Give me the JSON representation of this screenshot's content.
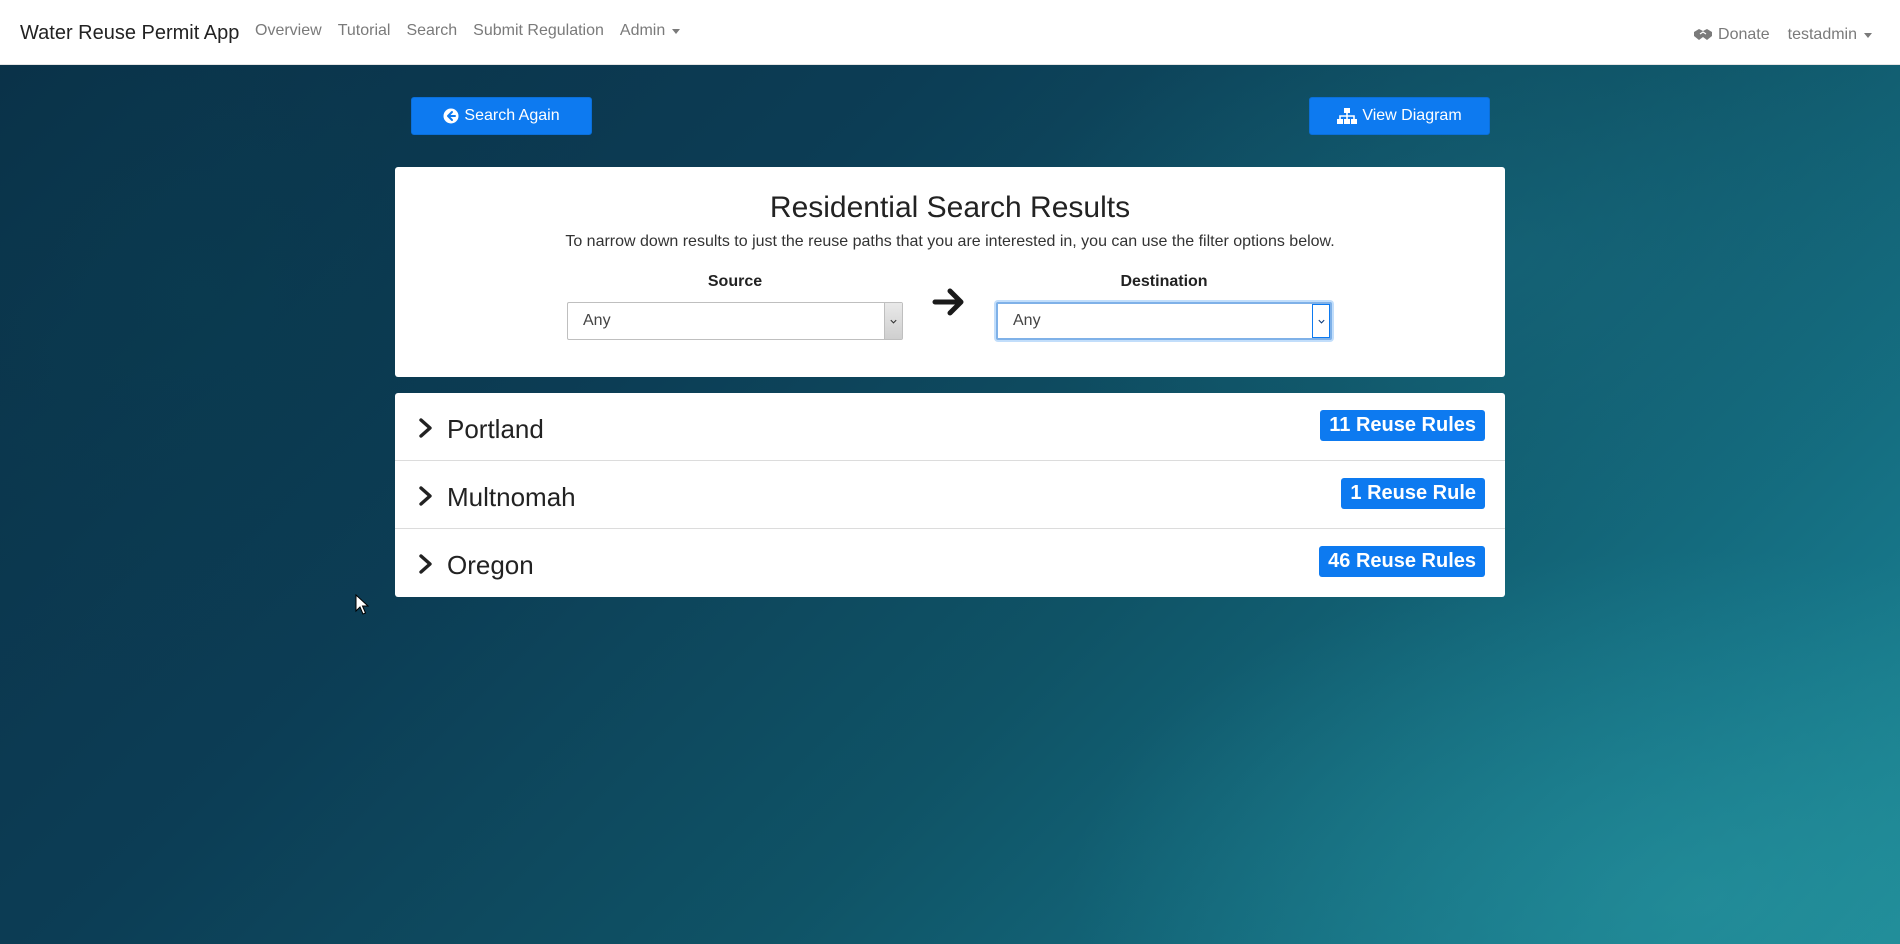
{
  "navbar": {
    "brand": "Water Reuse Permit App",
    "links": [
      "Overview",
      "Tutorial",
      "Search",
      "Submit Regulation",
      "Admin"
    ],
    "donate": "Donate",
    "user": "testadmin"
  },
  "buttons": {
    "search_again": "Search Again",
    "view_diagram": "View Diagram"
  },
  "results": {
    "title": "Residential Search Results",
    "description": "To narrow down results to just the reuse paths that you are interested in, you can use the filter options below.",
    "source_label": "Source",
    "source_value": "Any",
    "destination_label": "Destination",
    "destination_value": "Any"
  },
  "locations": [
    {
      "name": "Portland",
      "badge": "11 Reuse Rules"
    },
    {
      "name": "Multnomah",
      "badge": "1 Reuse Rule"
    },
    {
      "name": "Oregon",
      "badge": "46 Reuse Rules"
    }
  ],
  "icons": {
    "donate": "handshake-icon",
    "search_again": "arrow-circle-left-icon",
    "view_diagram": "sitemap-icon",
    "filter_arrow": "arrow-right-icon",
    "row_toggle": "chevron-right-icon"
  },
  "colors": {
    "primary": "#0d7af0",
    "navbar_bg": "#ffffff"
  }
}
